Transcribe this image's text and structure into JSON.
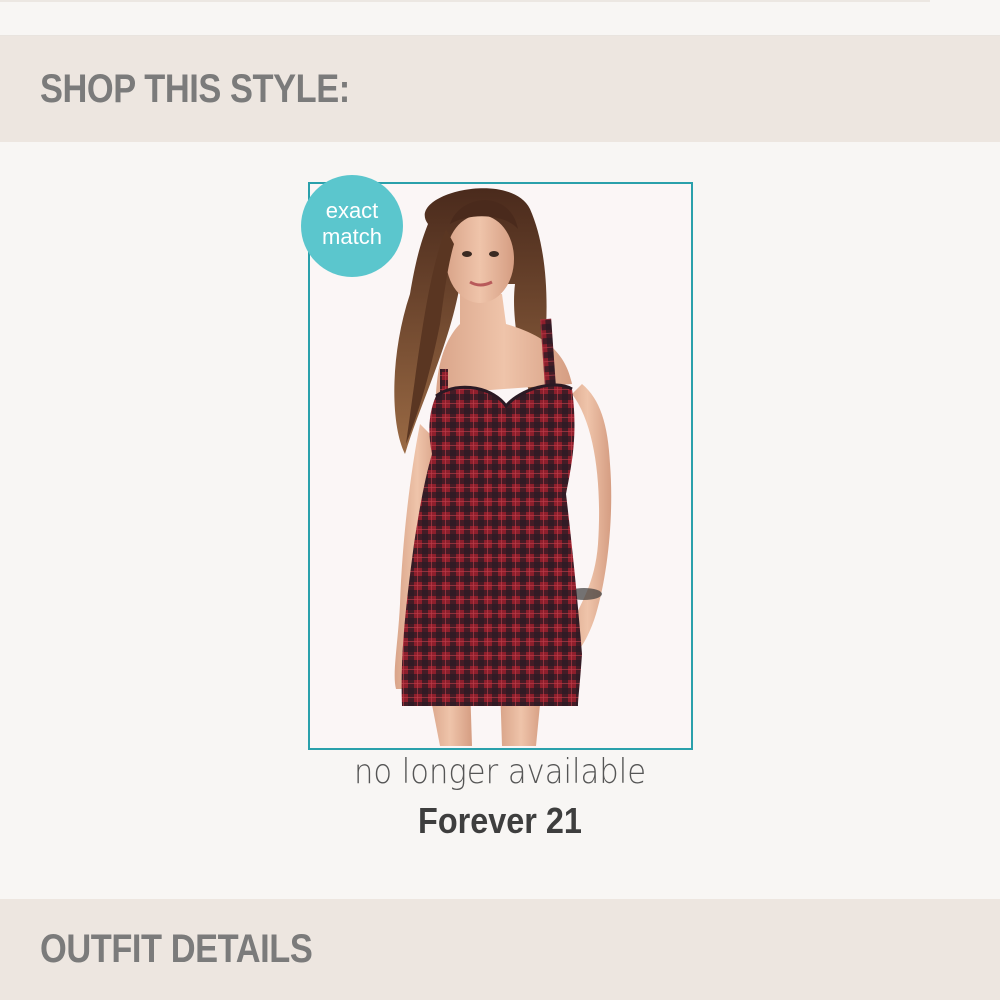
{
  "shop_section": {
    "title": "SHOP THIS STYLE:"
  },
  "product": {
    "badge_line1": "exact",
    "badge_line2": "match",
    "availability": "no longer available",
    "brand": "Forever 21",
    "image_alt": "Model wearing red and black plaid sweetheart bodycon dress"
  },
  "outfit_section": {
    "title": "OUTFIT DETAILS"
  },
  "colors": {
    "accent_border": "#2aa0ab",
    "badge": "#5bc6cd",
    "section_bar": "#ede6e0",
    "dress_red": "#8e1f2c",
    "dress_dark": "#2a1a24"
  }
}
